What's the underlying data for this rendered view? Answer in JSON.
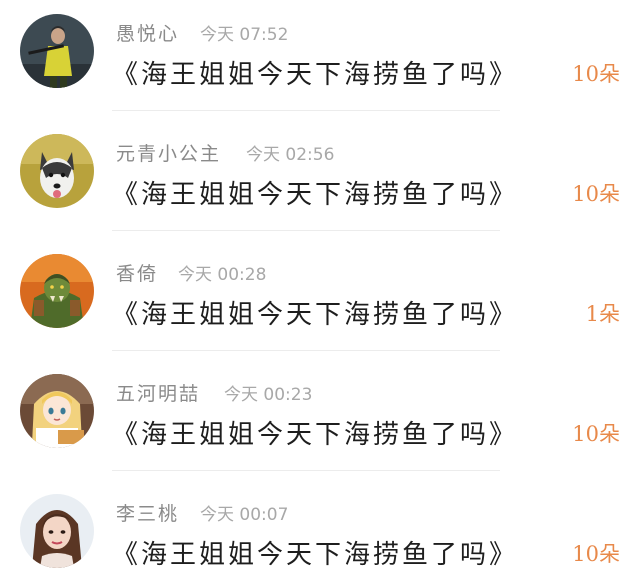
{
  "gift_list": {
    "items": [
      {
        "user_name": "愚悦心",
        "time": "今天 07:52",
        "message": "《海王姐姐今天下海捞鱼了吗》",
        "gift_count": "10朵",
        "avatar_icon": "avatar-soldier-icon"
      },
      {
        "user_name": "元青小公主",
        "time": "今天 02:56",
        "message": "《海王姐姐今天下海捞鱼了吗》",
        "gift_count": "10朵",
        "avatar_icon": "avatar-husky-dog-icon"
      },
      {
        "user_name": "香倚",
        "time": "今天 00:28",
        "message": "《海王姐姐今天下海捞鱼了吗》",
        "gift_count": "1朵",
        "avatar_icon": "avatar-orc-warrior-icon"
      },
      {
        "user_name": "五河明喆",
        "time": "今天 00:23",
        "message": "《海王姐姐今天下海捞鱼了吗》",
        "gift_count": "10朵",
        "avatar_icon": "avatar-anime-girl-icon"
      },
      {
        "user_name": "李三桃",
        "time": "今天 00:07",
        "message": "《海王姐姐今天下海捞鱼了吗》",
        "gift_count": "10朵",
        "avatar_icon": "avatar-woman-photo-icon"
      }
    ]
  },
  "colors": {
    "name": "#8a8a8a",
    "time": "#a8a8a8",
    "message": "#1e1e1e",
    "gift_count": "#e8894a",
    "divider": "#ececec"
  }
}
